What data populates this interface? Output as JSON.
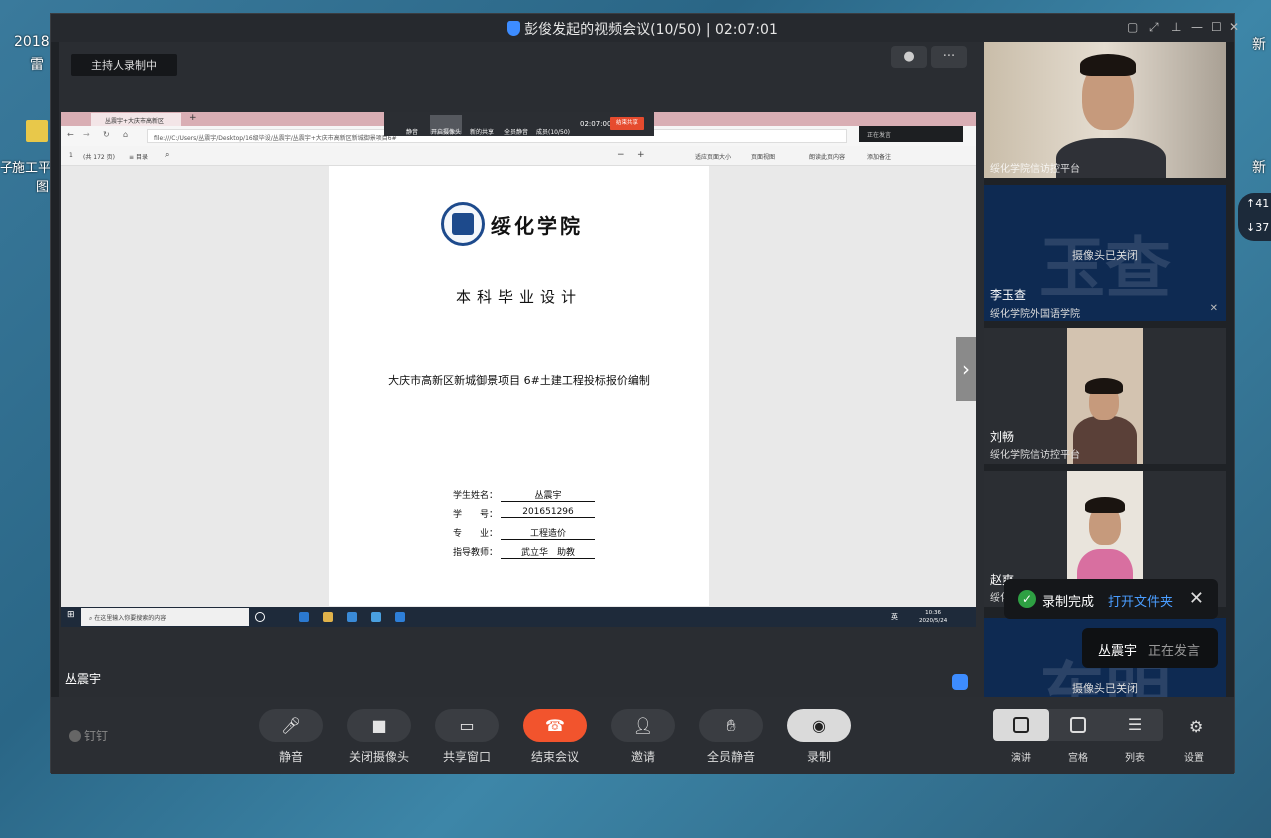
{
  "window": {
    "title": "彭俊发起的视频会议(10/50) | 02:07:01"
  },
  "desktop": {
    "label_2018": "2018",
    "label_lei": "雷",
    "label_dw_title": "施工平",
    "label_dw_sub": "图",
    "label_zi": "子",
    "label_new_right": "新",
    "label_new_right2": "新",
    "widget_up": "41",
    "widget_down": "37"
  },
  "stage": {
    "recording_badge": "主持人录制中",
    "speaker_name": "丛震宇"
  },
  "shared_screen": {
    "browser_tab": "丛震宇+大庆市高新区新",
    "address": "file:///C:/Users/丛震宇/Desktop/16级毕设/丛震宇/丛震宇+大庆市高新区新城御景项目6#",
    "page_num": "1",
    "page_count": "(共 172 页)",
    "contents": "目录",
    "fit_page": "适应页面大小",
    "page_view": "页面视图",
    "read_aloud": "朗读此页内容",
    "add_note": "添加备注",
    "meeting_bar": {
      "mute": "静音",
      "stop_camera": "开启摄像头",
      "share": "新的共享",
      "mute_all": "全员静音",
      "members": "成员(10/50)",
      "time": "02:07:00",
      "end_share": "结束共享"
    },
    "speaking_strip": "正在发言",
    "taskbar_search": "在这里输入你要搜索的内容",
    "taskbar_ime": "英",
    "taskbar_time": "10:36",
    "taskbar_date": "2020/5/24"
  },
  "document": {
    "school": "绥化学院",
    "doc_type": "本科毕业设计",
    "title": "大庆市高新区新城御景项目 6#土建工程投标报价编制",
    "fields": [
      {
        "label": "学生姓名：",
        "value": "丛震宇"
      },
      {
        "label": "学　　号：",
        "value": "201651296"
      },
      {
        "label": "专　　业：",
        "value": "工程造价"
      },
      {
        "label": "指导教师：",
        "value": "武立华　助教"
      }
    ]
  },
  "participants": [
    {
      "name": "",
      "org": "绥化学院信访控平台",
      "camera": "on"
    },
    {
      "name": "李玉查",
      "org": "绥化学院外国语学院",
      "camera": "off",
      "camera_off_text": "摄像头已关闭",
      "initials": "玉查"
    },
    {
      "name": "刘畅",
      "org": "绥化学院信访控平台",
      "camera": "on"
    },
    {
      "name": "赵爽",
      "org": "绥化学院信",
      "camera": "on"
    },
    {
      "name": "",
      "org": "",
      "camera": "off",
      "camera_off_text": "摄像头已关闭",
      "initials": "东明"
    }
  ],
  "toast": {
    "text": "录制完成",
    "link": "打开文件夹"
  },
  "speaking_chip": {
    "name": "丛震宇",
    "status": "正在发言"
  },
  "controls": {
    "brand": "钉钉",
    "mute": "静音",
    "camera": "关闭摄像头",
    "share": "共享窗口",
    "end": "结束会议",
    "invite": "邀请",
    "mute_all": "全员静音",
    "record": "录制",
    "view_speaker": "演讲",
    "view_grid": "宫格",
    "view_list": "列表",
    "settings": "设置"
  },
  "colors": {
    "end_button": "#f2542d",
    "link": "#4a9dff",
    "check": "#2ea043",
    "tile_blue": "#0e2a52"
  }
}
